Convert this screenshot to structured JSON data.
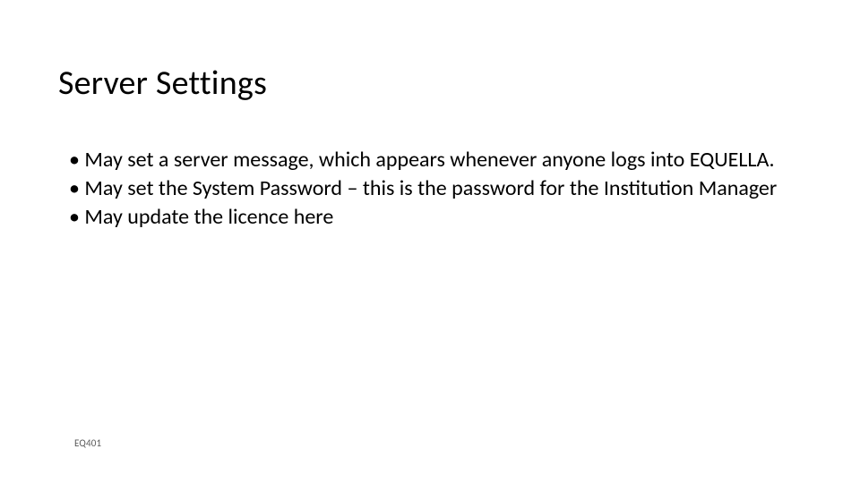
{
  "title": "Server Settings",
  "bullets": [
    "May set a server message, which appears whenever anyone logs into EQUELLA.",
    "May set the System Password – this is the password for the Institution Manager",
    "May update the licence here"
  ],
  "footer": "EQ401"
}
